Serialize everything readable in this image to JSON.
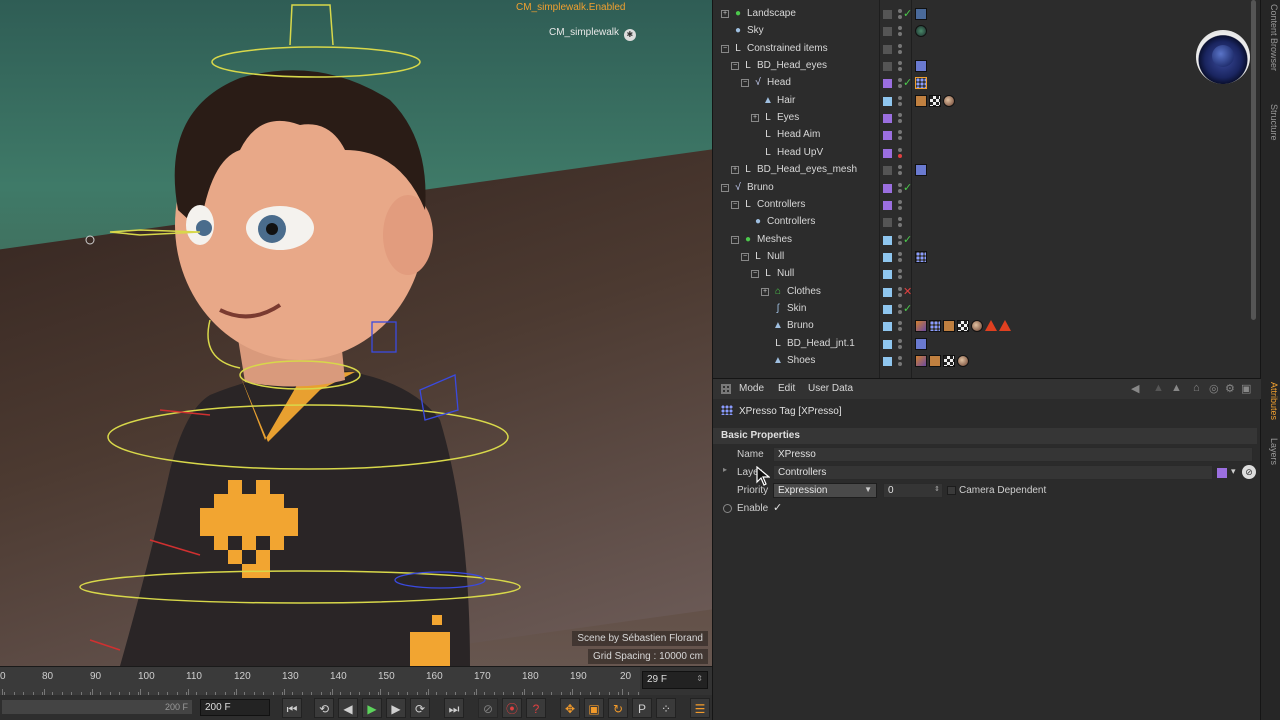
{
  "viewport": {
    "camera_tag": "CM_simplewalk.Enabled",
    "camera_name": "CM_simplewalk",
    "scene_credit": "Scene by Sébastien Florand",
    "grid_spacing": "Grid Spacing : 10000 cm",
    "colors": {
      "sky_top": "#2f5d55",
      "floor": "#4c3a31",
      "sweater": "#2a2526",
      "invader": "#f2a531",
      "skin": "#e8a888",
      "hair": "#2a1c16",
      "rig_yellow": "#d8d84a"
    }
  },
  "timeline": {
    "ticks": [
      "0",
      "80",
      "90",
      "100",
      "110",
      "120",
      "130",
      "140",
      "150",
      "160",
      "170",
      "180",
      "190",
      "20"
    ],
    "current_frame": "29 F",
    "range_end_bar": "200 F",
    "range_end_field": "200 F"
  },
  "object_manager": {
    "rows": [
      {
        "name": "Landscape",
        "icon": "green-circle",
        "depth": 0,
        "expander": "+",
        "layer": "",
        "vis": "gray",
        "check": "✓",
        "tags": [
          "cluster"
        ]
      },
      {
        "name": "Sky",
        "icon": "sky-circle",
        "depth": 0,
        "expander": "",
        "layer": "",
        "vis": "gray",
        "check": "",
        "tags": [
          "sphere"
        ]
      },
      {
        "name": "Constrained items",
        "icon": "null-L",
        "depth": 0,
        "expander": "−",
        "layer": "",
        "vis": "gray",
        "check": "",
        "tags": []
      },
      {
        "name": "BD_Head_eyes",
        "icon": "null-L",
        "depth": 1,
        "expander": "−",
        "layer": "",
        "vis": "gray",
        "check": "",
        "tags": [
          "constraint"
        ]
      },
      {
        "name": "Head",
        "icon": "joint",
        "depth": 2,
        "expander": "−",
        "layer": "#9b6fe0",
        "vis": "gray",
        "check": "✓",
        "tags": [
          "xpresso-selected"
        ]
      },
      {
        "name": "Hair",
        "icon": "polygon",
        "depth": 3,
        "expander": "",
        "layer": "#8fc6ef",
        "vis": "gray",
        "check": "",
        "tags": [
          "pose",
          "checker",
          "material"
        ]
      },
      {
        "name": "Eyes",
        "icon": "null-L",
        "depth": 3,
        "expander": "+",
        "layer": "#9b6fe0",
        "vis": "gray",
        "check": "",
        "tags": []
      },
      {
        "name": "Head Aim",
        "icon": "null-L",
        "depth": 3,
        "expander": "",
        "layer": "#9b6fe0",
        "vis": "gray",
        "check": "",
        "tags": []
      },
      {
        "name": "Head UpV",
        "icon": "null-L",
        "depth": 3,
        "expander": "",
        "layer": "#9b6fe0",
        "vis": "red",
        "check": "",
        "tags": []
      },
      {
        "name": "BD_Head_eyes_mesh",
        "icon": "null-L",
        "depth": 1,
        "expander": "+",
        "layer": "",
        "vis": "gray",
        "check": "",
        "tags": [
          "constraint"
        ]
      },
      {
        "name": "Bruno",
        "icon": "joint",
        "depth": 0,
        "expander": "−",
        "layer": "#9b6fe0",
        "vis": "gray",
        "check": "✓",
        "tags": []
      },
      {
        "name": "Controllers",
        "icon": "null-L",
        "depth": 1,
        "expander": "−",
        "layer": "#9b6fe0",
        "vis": "gray",
        "check": "",
        "tags": []
      },
      {
        "name": "Controllers",
        "icon": "ctrl-dot",
        "depth": 2,
        "expander": "",
        "layer": "",
        "vis": "gray",
        "check": "",
        "tags": []
      },
      {
        "name": "Meshes",
        "icon": "green-circle",
        "depth": 1,
        "expander": "−",
        "layer": "#8fc6ef",
        "vis": "gray",
        "check": "✓",
        "tags": []
      },
      {
        "name": "Null",
        "icon": "null-L",
        "depth": 2,
        "expander": "−",
        "layer": "#8fc6ef",
        "vis": "gray",
        "check": "",
        "tags": [
          "xpresso"
        ]
      },
      {
        "name": "Null",
        "icon": "null-L",
        "depth": 3,
        "expander": "−",
        "layer": "#8fc6ef",
        "vis": "gray",
        "check": "",
        "tags": []
      },
      {
        "name": "Clothes",
        "icon": "green-house",
        "depth": 4,
        "expander": "+",
        "layer": "#8fc6ef",
        "vis": "gray",
        "check": "✕",
        "tags": []
      },
      {
        "name": "Skin",
        "icon": "skin",
        "depth": 4,
        "expander": "",
        "layer": "#8fc6ef",
        "vis": "gray",
        "check": "✓",
        "tags": []
      },
      {
        "name": "Bruno",
        "icon": "polygon",
        "depth": 4,
        "expander": "",
        "layer": "#8fc6ef",
        "vis": "gray",
        "check": "",
        "tags": [
          "weight",
          "xpresso",
          "pose",
          "checker",
          "material",
          "warn",
          "warn"
        ]
      },
      {
        "name": "BD_Head_jnt.1",
        "icon": "null-L",
        "depth": 4,
        "expander": "",
        "layer": "#8fc6ef",
        "vis": "gray",
        "check": "",
        "tags": [
          "constraint"
        ]
      },
      {
        "name": "Shoes",
        "icon": "polygon",
        "depth": 4,
        "expander": "",
        "layer": "#8fc6ef",
        "vis": "gray",
        "check": "",
        "tags": [
          "weight",
          "pose",
          "checker",
          "material"
        ]
      }
    ]
  },
  "side_tabs": [
    "Content Browser",
    "Structure",
    "Attributes",
    "Layers"
  ],
  "attributes": {
    "menu": [
      "Mode",
      "Edit",
      "User Data"
    ],
    "title": "XPresso Tag [XPresso]",
    "section": "Basic Properties",
    "name_label": "Name",
    "name_value": "XPresso",
    "layer_label": "Layer",
    "layer_value": "Controllers",
    "layer_color": "#9b6fe0",
    "priority_label": "Priority",
    "priority_value": "Expression",
    "priority_number": "0",
    "camera_dependent_label": "Camera Dependent",
    "enable_label": "Enable",
    "enable_check": "✓"
  }
}
